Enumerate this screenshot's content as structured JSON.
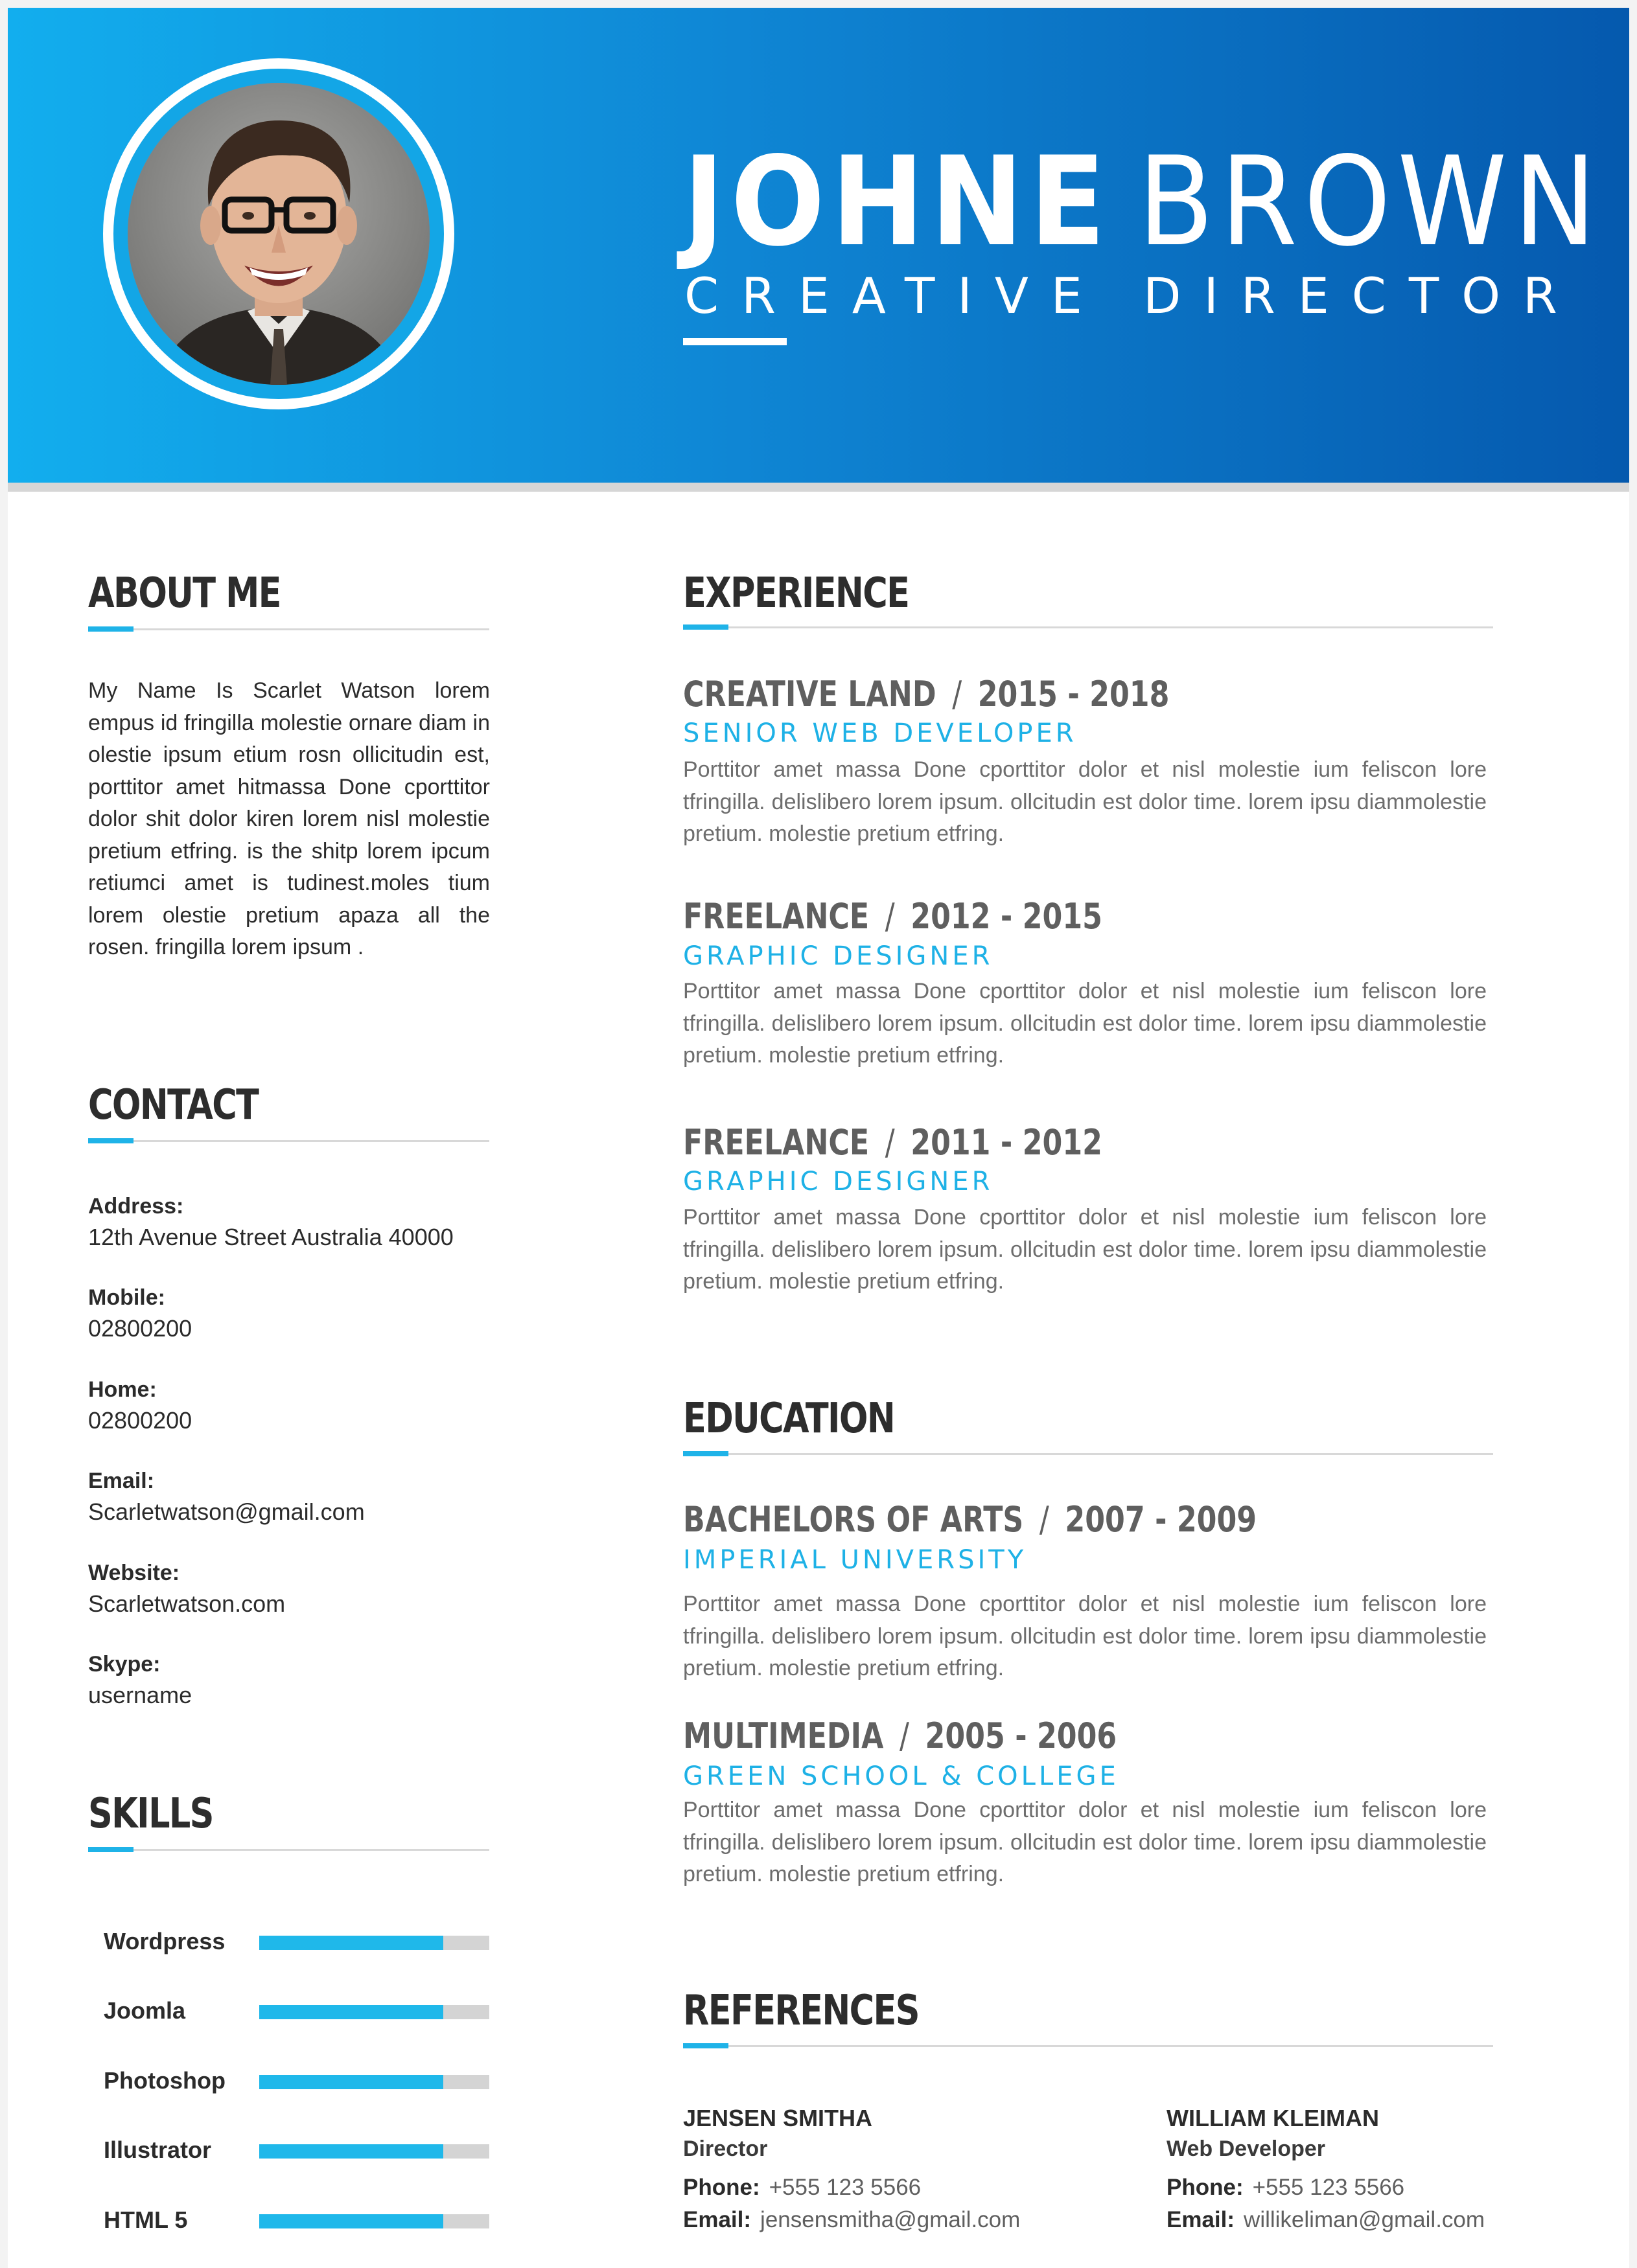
{
  "header": {
    "first_name": "JOHNE",
    "last_name": "BROWN",
    "title": "CREATIVE DIRECTOR"
  },
  "photo": {
    "icon": "profile-photo"
  },
  "about": {
    "heading": "ABOUT ME",
    "text": "My Name Is Scarlet Watson lorem empus id fringilla molestie ornare diam in olestie ipsum etium rosn ollicitudin est, porttitor amet hitmassa Done cporttitor dolor shit dolor kiren lorem nisl molestie pretium etfring. is the shitp lorem ipcum retiumci amet is tudinest.moles tium lorem olestie pretium apaza all the rosen. fringilla lorem ipsum ."
  },
  "contact": {
    "heading": "CONTACT",
    "items": [
      {
        "label": "Address:",
        "value": "12th Avenue Street Australia 40000"
      },
      {
        "label": "Mobile:",
        "value": "02800200"
      },
      {
        "label": "Home:",
        "value": "02800200"
      },
      {
        "label": "Email:",
        "value": "Scarletwatson@gmail.com"
      },
      {
        "label": "Website:",
        "value": "Scarletwatson.com"
      },
      {
        "label": "Skype:",
        "value": "username"
      }
    ]
  },
  "skills": {
    "heading": "SKILLS",
    "items": [
      {
        "label": "Wordpress",
        "level": 0.8
      },
      {
        "label": "Joomla",
        "level": 0.8
      },
      {
        "label": "Photoshop",
        "level": 0.8
      },
      {
        "label": "Illustrator",
        "level": 0.8
      },
      {
        "label": "HTML 5",
        "level": 0.8
      }
    ]
  },
  "experience": {
    "heading": "EXPERIENCE",
    "items": [
      {
        "company": "CREATIVE LAND",
        "years": "2015 - 2018",
        "role": "SENIOR WEB DEVELOPER",
        "desc": "Porttitor amet massa Done cporttitor dolor et nisl molestie ium feliscon lore tfringilla. delislibero lorem ipsum. ollcitudin est dolor time. lorem ipsu diammolestie pretium. molestie pretium etfring."
      },
      {
        "company": "FREELANCE",
        "years": "2012 - 2015",
        "role": "GRAPHIC DESIGNER",
        "desc": "Porttitor amet massa Done cporttitor dolor et nisl molestie ium feliscon lore tfringilla. delislibero lorem ipsum. ollcitudin est dolor time. lorem ipsu diammolestie pretium. molestie pretium etfring."
      },
      {
        "company": "FREELANCE",
        "years": "2011 - 2012",
        "role": "GRAPHIC DESIGNER",
        "desc": "Porttitor amet massa Done cporttitor dolor et nisl molestie ium feliscon lore tfringilla. delislibero lorem ipsum. ollcitudin est dolor time. lorem ipsu diammolestie pretium. molestie pretium etfring."
      }
    ]
  },
  "education": {
    "heading": "EDUCATION",
    "items": [
      {
        "degree": "BACHELORS OF ARTS",
        "years": "2007 - 2009",
        "school": "IMPERIAL UNIVERSITY",
        "desc": "Porttitor amet massa Done cporttitor dolor et nisl molestie ium feliscon lore tfringilla. delislibero lorem ipsum. ollcitudin est dolor time. lorem ipsu diammolestie pretium. molestie pretium etfring."
      },
      {
        "degree": "MULTIMEDIA",
        "years": "2005 - 2006",
        "school": "GREEN SCHOOL & COLLEGE",
        "desc": "Porttitor amet massa Done cporttitor dolor et nisl molestie ium feliscon lore tfringilla. delislibero lorem ipsum. ollcitudin est dolor time. lorem ipsu diammolestie pretium. molestie pretium etfring."
      }
    ]
  },
  "references": {
    "heading": "REFERENCES",
    "phone_label": "Phone:",
    "email_label": "Email:",
    "items": [
      {
        "name": "JENSEN SMITHA",
        "role": "Director",
        "phone": "+555 123 5566",
        "email": "jensensmitha@gmail.com"
      },
      {
        "name": "WILLIAM KLEIMAN",
        "role": "Web Developer",
        "phone": "+555 123 5566",
        "email": "willikeliman@gmail.com"
      }
    ]
  },
  "colors": {
    "accent": "#1fb3e8",
    "header_start": "#12aeee",
    "header_end": "#0559ae"
  }
}
